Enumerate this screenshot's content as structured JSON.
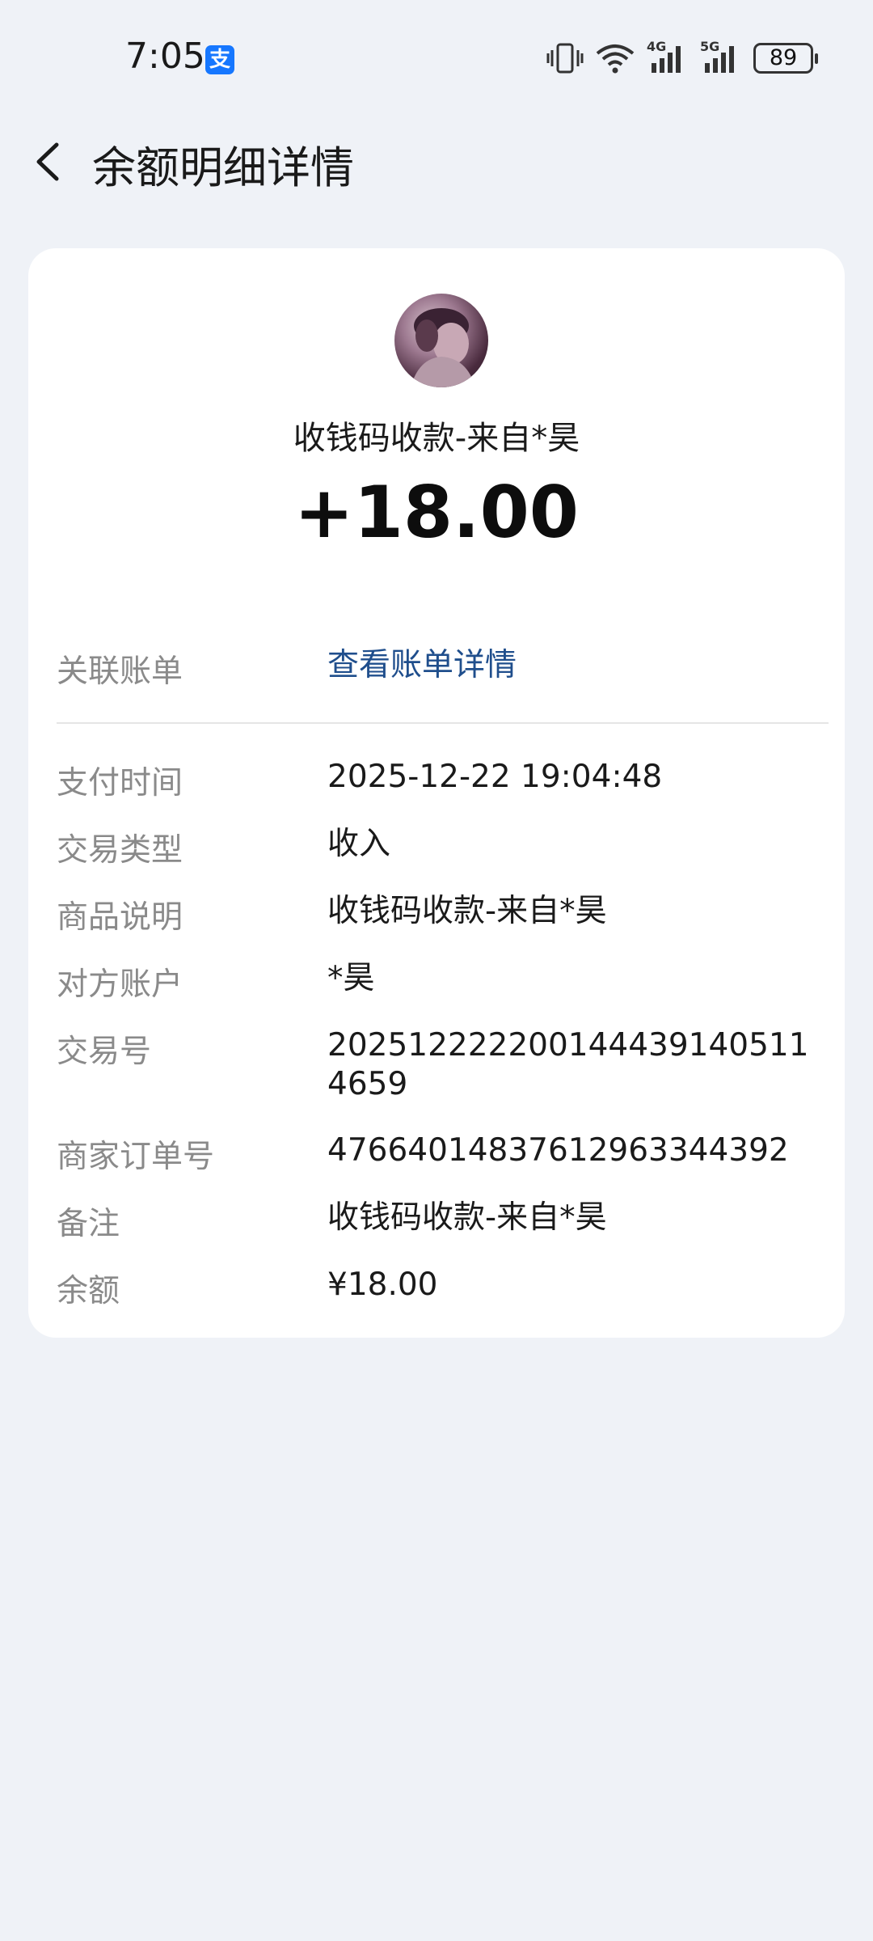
{
  "status_bar": {
    "time": "7:05",
    "app_badge": "支",
    "battery": "89",
    "network_1": "4G",
    "network_2": "5G"
  },
  "header": {
    "title": "余额明细详情"
  },
  "transaction": {
    "merchant_title": "收钱码收款-来自*昊",
    "amount": "+18.00"
  },
  "link_row": {
    "label": "关联账单",
    "link_text": "查看账单详情"
  },
  "details": [
    {
      "label": "支付时间",
      "value": "2025-12-22 19:04:48"
    },
    {
      "label": "交易类型",
      "value": "收入"
    },
    {
      "label": "商品说明",
      "value": "收钱码收款-来自*昊"
    },
    {
      "label": "对方账户",
      "value": "*昊"
    },
    {
      "label": "交易号",
      "value": "2025122222001444391405114659"
    },
    {
      "label": "商家订单号",
      "value": "476640148376129633443​92"
    },
    {
      "label": "备注",
      "value": "收钱码收款-来自*昊"
    },
    {
      "label": "余额",
      "value": "¥18.00"
    }
  ],
  "colors": {
    "background": "#eff2f7",
    "link": "#1f4e8c",
    "label": "#8a8a8a",
    "badge": "#1677ff"
  }
}
